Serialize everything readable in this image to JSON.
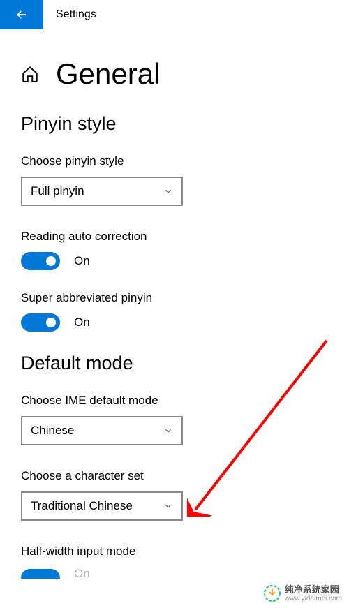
{
  "header": {
    "title": "Settings"
  },
  "page": {
    "title": "General"
  },
  "sections": {
    "pinyin_style": {
      "title": "Pinyin style",
      "choose_style": {
        "label": "Choose pinyin style",
        "value": "Full pinyin"
      },
      "reading_auto_correction": {
        "label": "Reading auto correction",
        "state": "On"
      },
      "super_abbreviated": {
        "label": "Super abbreviated pinyin",
        "state": "On"
      }
    },
    "default_mode": {
      "title": "Default mode",
      "choose_ime": {
        "label": "Choose IME default mode",
        "value": "Chinese"
      },
      "choose_charset": {
        "label": "Choose a character set",
        "value": "Traditional Chinese"
      },
      "half_width": {
        "label": "Half-width input mode",
        "state": "On"
      }
    }
  },
  "watermark": {
    "main": "纯净系统家园",
    "url": "www.yidaimei.com"
  }
}
